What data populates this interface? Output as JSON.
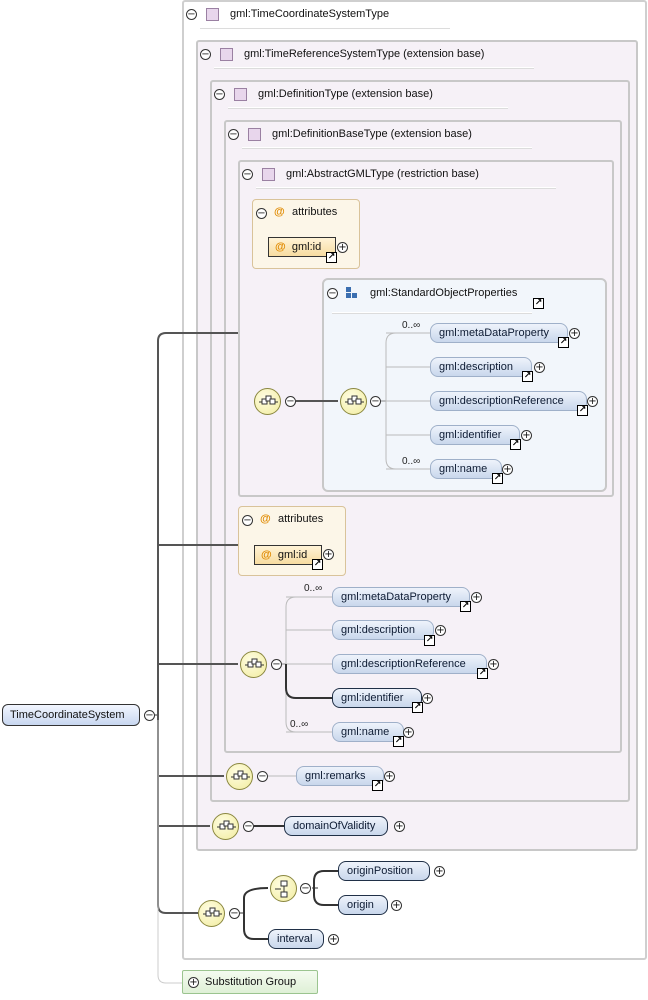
{
  "root": {
    "label": "TimeCoordinateSystem"
  },
  "types": {
    "tcs": "gml:TimeCoordinateSystemType",
    "trs": "gml:TimeReferenceSystemType (extension base)",
    "def": "gml:DefinitionType (extension base)",
    "defbase": "gml:DefinitionBaseType (extension base)",
    "abstract": "gml:AbstractGMLType (restriction base)"
  },
  "attributes_label": "attributes",
  "attr_at": "@",
  "attr_id": "gml:id",
  "group": {
    "label": "gml:StandardObjectProperties",
    "elements": [
      "gml:metaDataProperty",
      "gml:description",
      "gml:descriptionReference",
      "gml:identifier",
      "gml:name"
    ]
  },
  "defbase_elements": [
    "gml:metaDataProperty",
    "gml:description",
    "gml:descriptionReference",
    "gml:identifier",
    "gml:name"
  ],
  "occurrence": "0..∞",
  "def_elements": [
    "gml:remarks"
  ],
  "trs_elements": [
    "domainOfValidity"
  ],
  "tcs_elements": {
    "choice": [
      "originPosition",
      "origin"
    ],
    "interval": "interval"
  },
  "substitution": "Substitution Group",
  "icons": {
    "toggle_open": "⊖",
    "expand": "⊕",
    "link": "↗"
  }
}
